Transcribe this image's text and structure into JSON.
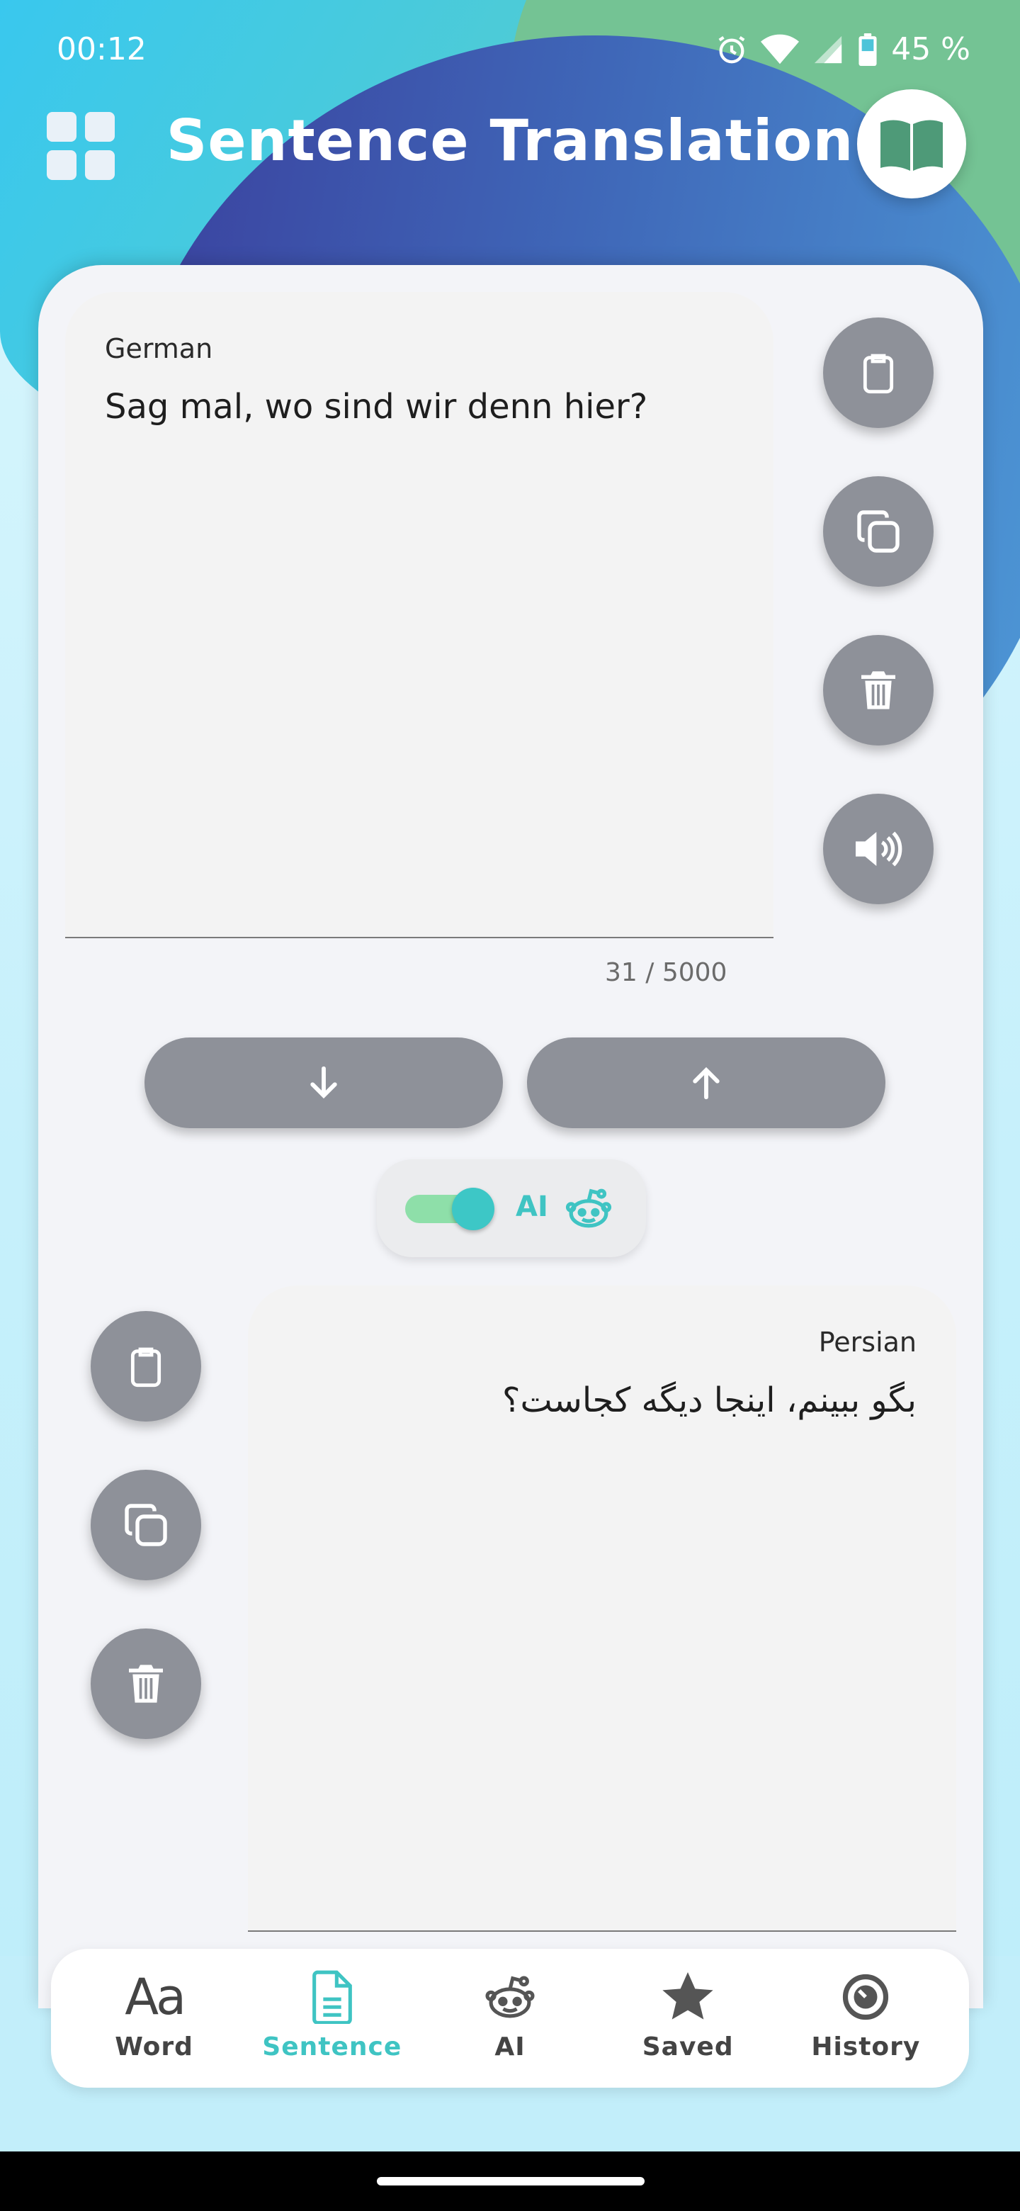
{
  "status": {
    "time": "00:12",
    "battery": "45 %",
    "icons": [
      "alarm-icon",
      "wifi-icon",
      "signal-icon",
      "battery-icon"
    ]
  },
  "header": {
    "title": "Sentence Translation",
    "menu_icon": "grid-icon",
    "book_icon": "book-icon"
  },
  "source": {
    "language": "German",
    "text": "Sag mal, wo sind wir denn hier?",
    "char_count": "31 / 5000",
    "actions": [
      "paste-icon",
      "copy-icon",
      "trash-icon",
      "speaker-icon"
    ]
  },
  "swap": {
    "down_icon": "arrow-down-icon",
    "up_icon": "arrow-up-icon"
  },
  "ai_toggle": {
    "label": "AI",
    "enabled": true,
    "icon": "robot-icon"
  },
  "target": {
    "language": "Persian",
    "text": "بگو ببینم، اینجا دیگه کجاست؟",
    "actions": [
      "paste-icon",
      "copy-icon",
      "trash-icon"
    ]
  },
  "bottom_nav": {
    "items": [
      {
        "label": "Word",
        "icon": "aa-icon",
        "glyph": "Aa"
      },
      {
        "label": "Sentence",
        "icon": "document-icon"
      },
      {
        "label": "AI",
        "icon": "robot-icon"
      },
      {
        "label": "Saved",
        "icon": "star-icon"
      },
      {
        "label": "History",
        "icon": "clock-icon"
      }
    ],
    "active": "Sentence"
  },
  "colors": {
    "accent": "#3fc4c3",
    "fab_gray": "#8e9199",
    "book_green": "#4e9a78"
  }
}
